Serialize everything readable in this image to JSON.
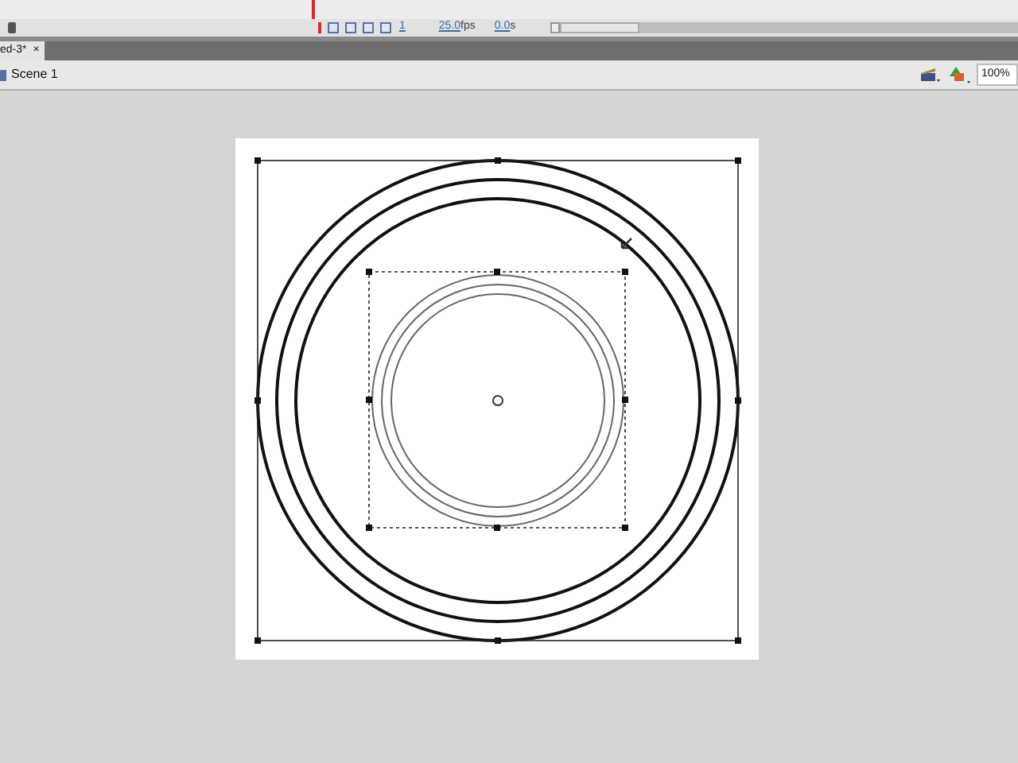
{
  "timeline": {
    "frame": "1",
    "frame_rate": {
      "value": "25.0",
      "unit": "fps"
    },
    "elapsed": {
      "value": "0.0",
      "unit": "s"
    }
  },
  "tabs": [
    {
      "label": "ed-3*",
      "close": "×",
      "selected": true
    }
  ],
  "edit_bar": {
    "scene": "Scene 1",
    "zoom": "100%"
  }
}
